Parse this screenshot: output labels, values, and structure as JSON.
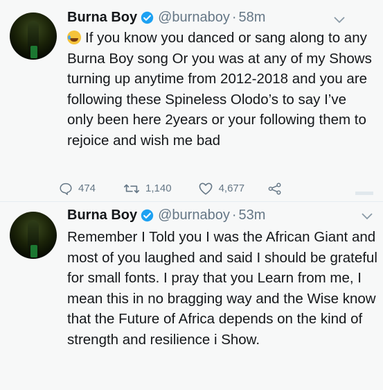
{
  "tweets": [
    {
      "name": "Burna Boy",
      "handle": "@burnaboy",
      "separator": "·",
      "time": "58m",
      "emoji": "face-with-tears-of-joy",
      "text": "If you know you danced or sang along to any Burna Boy song Or you was at any of my Shows turning up anytime from 2012-2018 and you are following these Spineless Olodo’s to say I’ve only been here 2years or your following them to rejoice and wish me bad",
      "replies": "474",
      "retweets": "1,140",
      "likes": "4,677"
    },
    {
      "name": "Burna Boy",
      "handle": "@burnaboy",
      "separator": "·",
      "time": "53m",
      "text": "Remember I Told you I was the African Giant and most of you laughed and said I should be grateful for small fonts.  I pray that you Learn from me, I mean this in no bragging way and the Wise know that the Future of Africa depends on the kind of strength and resilience i Show."
    }
  ],
  "colors": {
    "verified": "#1da1f2",
    "muted": "#657786",
    "text": "#14171a"
  }
}
